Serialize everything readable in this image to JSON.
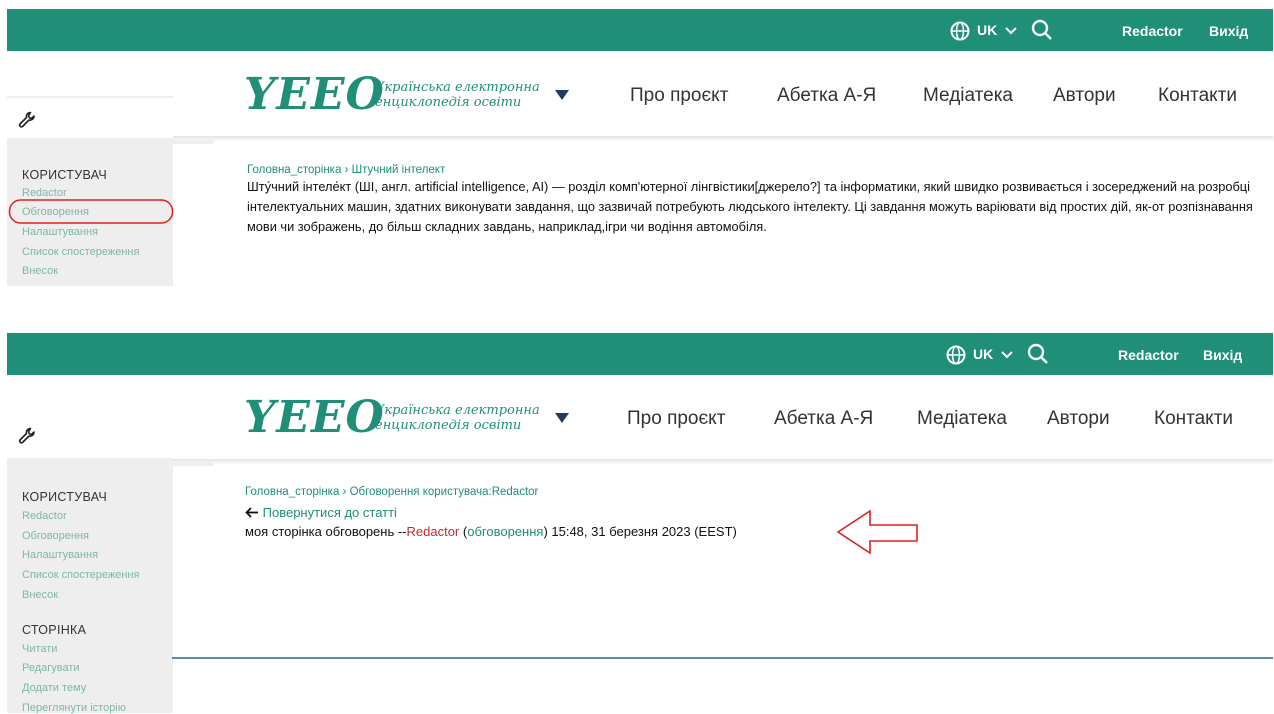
{
  "topbar": {
    "lang": "UK",
    "user": "Redactor",
    "logout": "Вихід"
  },
  "logo": {
    "main": "YEEO",
    "sub_line1": "Українська електронна",
    "sub_line2": "енциклопедія освіти"
  },
  "nav": [
    "Про проєкт",
    "Абетка А-Я",
    "Медіатека",
    "Автори",
    "Контакти"
  ],
  "sidebar": {
    "user_heading": "КОРИСТУВАЧ",
    "user_items": [
      "Redactor",
      "Обговорення",
      "Налаштування",
      "Список спостереження",
      "Внесок"
    ],
    "page_heading": "СТОРІНКА",
    "page_items": [
      "Читати",
      "Редагувати",
      "Додати тему",
      "Переглянути історію"
    ]
  },
  "panel1": {
    "breadcrumb": "Головна_сторінка › Штучний інтелект",
    "paragraph": "Шту́чний інтеле́кт (ШІ, англ. artificial intelligence, AI) — розділ комп'ютерної лінгвістики[джерело?] та інформатики, який швидко розвивається і зосереджений на розробці інтелектуальних машин, здатних виконувати завдання, що зазвичай потребують людського інтелекту. Ці завдання можуть варіювати від простих дій, як-от розпізнавання мови чи зображень, до більш складних завдань, наприклад,ігри чи водіння автомобіля."
  },
  "panel2": {
    "breadcrumb": "Головна_сторінка › Обговорення користувача:Redactor",
    "back_link": "Повернутися до статті",
    "comment_text": "моя сторінка обговорень --",
    "comment_user": "Redactor",
    "comment_paren_open": " (",
    "comment_talk": "обговорення",
    "comment_time": ") 15:48, 31 березня 2023 (EEST)"
  },
  "colors": {
    "brand": "#1f8f78",
    "link": "#7fb5aa",
    "annotation": "#e02020"
  }
}
